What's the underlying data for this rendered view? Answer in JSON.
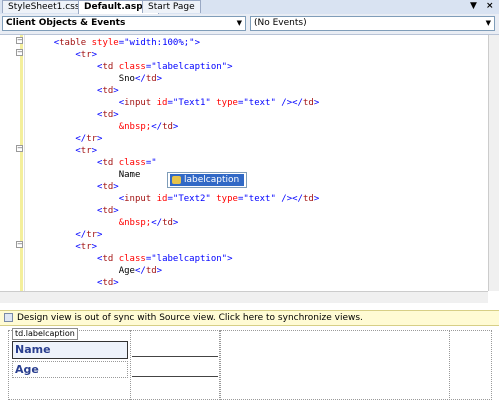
{
  "tabs": [
    {
      "label": "StyleSheet1.css",
      "active": false
    },
    {
      "label": "Default.aspx*",
      "active": true
    },
    {
      "label": "Start Page",
      "active": false
    }
  ],
  "tab_controls": {
    "pin": "▼",
    "close": "×"
  },
  "nav": {
    "left_combo": "Client Objects & Events",
    "right_combo": "(No Events)"
  },
  "code_lines": [
    {
      "indent": "    ",
      "parts": [
        [
          "blue",
          "<"
        ],
        [
          "red",
          "table"
        ],
        [
          "attr",
          " style"
        ],
        [
          "blue",
          "=\"width:100%;\">"
        ]
      ]
    },
    {
      "indent": "        ",
      "parts": [
        [
          "blue",
          "<"
        ],
        [
          "red",
          "tr"
        ],
        [
          "blue",
          ">"
        ]
      ]
    },
    {
      "indent": "            ",
      "parts": [
        [
          "blue",
          "<"
        ],
        [
          "red",
          "td"
        ],
        [
          "attr",
          " class"
        ],
        [
          "blue",
          "=\"labelcaption\">"
        ]
      ]
    },
    {
      "indent": "                ",
      "parts": [
        [
          "black",
          "Sno"
        ],
        [
          "blue",
          "</"
        ],
        [
          "red",
          "td"
        ],
        [
          "blue",
          ">"
        ]
      ]
    },
    {
      "indent": "            ",
      "parts": [
        [
          "blue",
          "<"
        ],
        [
          "red",
          "td"
        ],
        [
          "blue",
          ">"
        ]
      ]
    },
    {
      "indent": "                ",
      "parts": [
        [
          "blue",
          "<"
        ],
        [
          "red",
          "input"
        ],
        [
          "attr",
          " id"
        ],
        [
          "blue",
          "=\"Text1\""
        ],
        [
          "attr",
          " type"
        ],
        [
          "blue",
          "=\"text\""
        ],
        [
          "blue",
          " /></"
        ],
        [
          "red",
          "td"
        ],
        [
          "blue",
          ">"
        ]
      ]
    },
    {
      "indent": "            ",
      "parts": [
        [
          "blue",
          "<"
        ],
        [
          "red",
          "td"
        ],
        [
          "blue",
          ">"
        ]
      ]
    },
    {
      "indent": "                ",
      "parts": [
        [
          "attr",
          "&nbsp;"
        ],
        [
          "blue",
          "</"
        ],
        [
          "red",
          "td"
        ],
        [
          "blue",
          ">"
        ]
      ]
    },
    {
      "indent": "        ",
      "parts": [
        [
          "blue",
          "</"
        ],
        [
          "red",
          "tr"
        ],
        [
          "blue",
          ">"
        ]
      ]
    },
    {
      "indent": "        ",
      "parts": [
        [
          "blue",
          "<"
        ],
        [
          "red",
          "tr"
        ],
        [
          "blue",
          ">"
        ]
      ]
    },
    {
      "indent": "            ",
      "parts": [
        [
          "blue",
          "<"
        ],
        [
          "red",
          "td"
        ],
        [
          "attr",
          " class"
        ],
        [
          "blue",
          "=\""
        ]
      ]
    },
    {
      "indent": "                ",
      "parts": [
        [
          "black",
          "Name"
        ]
      ]
    },
    {
      "indent": "            ",
      "parts": [
        [
          "blue",
          "<"
        ],
        [
          "red",
          "td"
        ],
        [
          "blue",
          ">"
        ]
      ]
    },
    {
      "indent": "                ",
      "parts": [
        [
          "blue",
          "<"
        ],
        [
          "red",
          "input"
        ],
        [
          "attr",
          " id"
        ],
        [
          "blue",
          "=\"Text2\""
        ],
        [
          "attr",
          " type"
        ],
        [
          "blue",
          "=\"text\""
        ],
        [
          "blue",
          " /></"
        ],
        [
          "red",
          "td"
        ],
        [
          "blue",
          ">"
        ]
      ]
    },
    {
      "indent": "            ",
      "parts": [
        [
          "blue",
          "<"
        ],
        [
          "red",
          "td"
        ],
        [
          "blue",
          ">"
        ]
      ]
    },
    {
      "indent": "                ",
      "parts": [
        [
          "attr",
          "&nbsp;"
        ],
        [
          "blue",
          "</"
        ],
        [
          "red",
          "td"
        ],
        [
          "blue",
          ">"
        ]
      ]
    },
    {
      "indent": "        ",
      "parts": [
        [
          "blue",
          "</"
        ],
        [
          "red",
          "tr"
        ],
        [
          "blue",
          ">"
        ]
      ]
    },
    {
      "indent": "        ",
      "parts": [
        [
          "blue",
          "<"
        ],
        [
          "red",
          "tr"
        ],
        [
          "blue",
          ">"
        ]
      ]
    },
    {
      "indent": "            ",
      "parts": [
        [
          "blue",
          "<"
        ],
        [
          "red",
          "td"
        ],
        [
          "attr",
          " class"
        ],
        [
          "blue",
          "=\"labelcaption\">"
        ]
      ]
    },
    {
      "indent": "                ",
      "parts": [
        [
          "black",
          "Age"
        ],
        [
          "blue",
          "</"
        ],
        [
          "red",
          "td"
        ],
        [
          "blue",
          ">"
        ]
      ]
    },
    {
      "indent": "            ",
      "parts": [
        [
          "blue",
          "<"
        ],
        [
          "red",
          "td"
        ],
        [
          "blue",
          ">"
        ]
      ]
    }
  ],
  "intellisense": {
    "selected_item": "labelcaption",
    "icon": "property-icon"
  },
  "sync_bar": {
    "message": "Design view is out of sync with Source view. Click here to synchronize views."
  },
  "design": {
    "tag_label": "td.labelcaption",
    "rows": [
      {
        "label": "Name",
        "selected": true
      },
      {
        "label": "Age",
        "selected": false
      }
    ]
  },
  "colors": {
    "accent": "#3169c6",
    "keyword_blue": "#0000ff",
    "tag_red": "#a31515",
    "attr_red": "#ff0000",
    "label_blue": "#2a3f8f"
  }
}
